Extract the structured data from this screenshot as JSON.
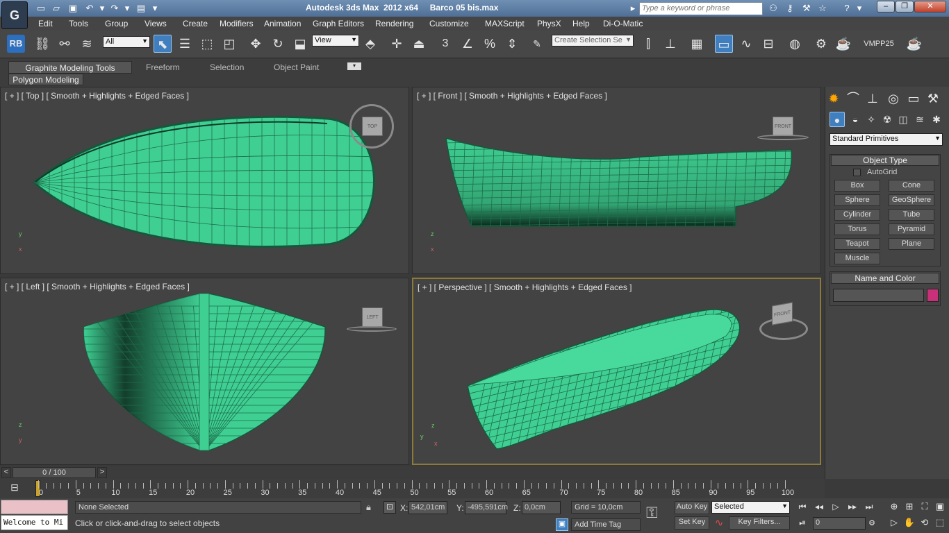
{
  "titlebar": {
    "app_title": "Autodesk 3ds Max  2012 x64     Barco 05 bis.max",
    "search_placeholder": "Type a keyword or phrase",
    "logo_text": "G"
  },
  "menu": [
    "Edit",
    "Tools",
    "Group",
    "Views",
    "Create",
    "Modifiers",
    "Animation",
    "Graph Editors",
    "Rendering",
    "Customize",
    "MAXScript",
    "PhysX",
    "Help",
    "Di-O-Matic"
  ],
  "toolbar": {
    "rb_label": "RB",
    "filter_value": "All",
    "refcoord_value": "View",
    "snap_label": "3",
    "selection_set_placeholder": "Create Selection Se",
    "vmpp_label": "VMPP25"
  },
  "ribbon": {
    "tabs": [
      "Graphite Modeling Tools",
      "Freeform",
      "Selection",
      "Object Paint"
    ],
    "active_tab": "Graphite Modeling Tools",
    "sub_label": "Polygon Modeling"
  },
  "viewports": {
    "top": {
      "label": "[ + ] [ Top ] [ Smooth + Highlights + Edged Faces ]",
      "cube": "TOP"
    },
    "front": {
      "label": "[ + ] [ Front ] [ Smooth + Highlights + Edged Faces ]",
      "cube": "FRONT"
    },
    "left": {
      "label": "[ + ] [ Left ] [ Smooth + Highlights + Edged Faces ]",
      "cube": "LEFT"
    },
    "perspective": {
      "label": "[ + ] [ Perspective ] [ Smooth + Highlights + Edged Faces ]",
      "cube": "FRONT"
    }
  },
  "command_panel": {
    "category_dropdown": "Standard Primitives",
    "object_type_title": "Object Type",
    "autogrid_label": "AutoGrid",
    "buttons": [
      "Box",
      "Cone",
      "Sphere",
      "GeoSphere",
      "Cylinder",
      "Tube",
      "Torus",
      "Pyramid",
      "Teapot",
      "Plane",
      "Muscle"
    ],
    "name_color_title": "Name and Color",
    "name_value": "",
    "color_swatch": "#c8317a"
  },
  "timeline": {
    "frame_display": "0 / 100",
    "ticks": [
      "0",
      "5",
      "10",
      "15",
      "20",
      "25",
      "30",
      "35",
      "40",
      "45",
      "50",
      "55",
      "60",
      "65",
      "70",
      "75",
      "80",
      "85",
      "90",
      "95",
      "100"
    ]
  },
  "status": {
    "selection": "None Selected",
    "prompt": "Click or click-and-drag to select objects",
    "listener": "Welcome to Mi",
    "x_label": "X:",
    "x_value": "542,01cm",
    "y_label": "Y:",
    "y_value": "-495,591cm",
    "z_label": "Z:",
    "z_value": "0,0cm",
    "grid": "Grid = 10,0cm",
    "add_time_tag": "Add Time Tag",
    "auto_key": "Auto Key",
    "set_key": "Set Key",
    "key_mode": "Selected",
    "key_filters": "Key Filters...",
    "current_frame": "0"
  },
  "colors": {
    "mesh_fill": "#3fcf93",
    "mesh_wire": "#1e6e4c",
    "viewport_bg": "#434343",
    "active_border": "#8d7a3b"
  }
}
